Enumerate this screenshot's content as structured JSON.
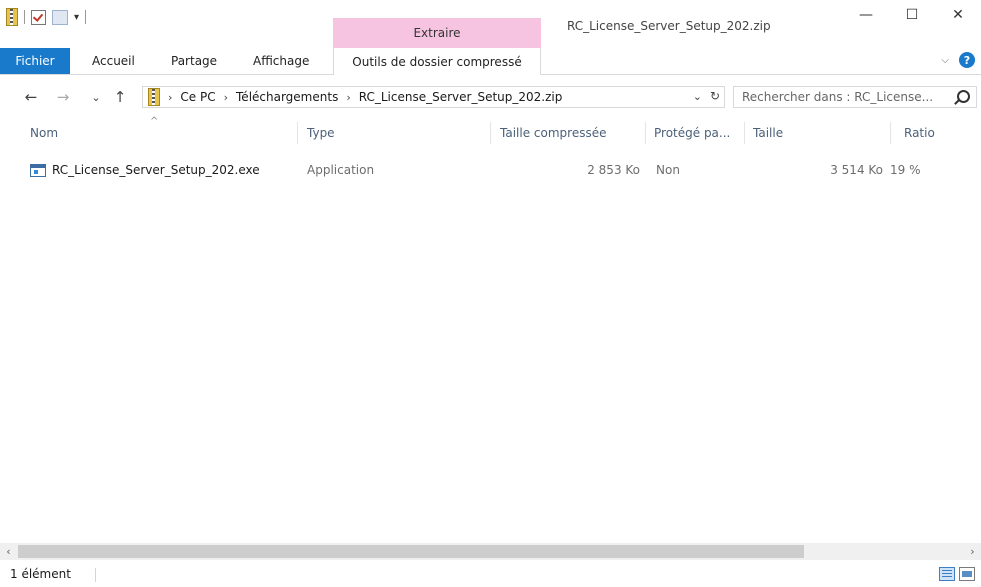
{
  "window": {
    "title": "RC_License_Server_Setup_202.zip",
    "controls": {
      "minimize": "—",
      "maximize": "☐",
      "close": "✕"
    }
  },
  "contextual_tab": {
    "group_label": "Extraire",
    "tab_label": "Outils de dossier compressé",
    "color": "#f6c4e0"
  },
  "ribbon": {
    "tabs": [
      "Fichier",
      "Accueil",
      "Partage",
      "Affichage"
    ],
    "file_color": "#1979ca",
    "help": "?"
  },
  "navigation": {
    "back": "←",
    "forward": "→",
    "recent": "⌄",
    "up": "↑",
    "breadcrumbs": [
      "Ce PC",
      "Téléchargements",
      "RC_License_Server_Setup_202.zip"
    ],
    "refresh": "↻",
    "dropdown": "⌄"
  },
  "search": {
    "placeholder": "Rechercher dans : RC_License..."
  },
  "columns": {
    "name": "Nom",
    "type": "Type",
    "compressed": "Taille compressée",
    "protected": "Protégé pa...",
    "size": "Taille",
    "ratio": "Ratio"
  },
  "files": [
    {
      "name": "RC_License_Server_Setup_202.exe",
      "type": "Application",
      "compressed": "2 853 Ko",
      "protected": "Non",
      "size": "3 514 Ko",
      "ratio": "19 %"
    }
  ],
  "status": {
    "count": "1 élément"
  }
}
